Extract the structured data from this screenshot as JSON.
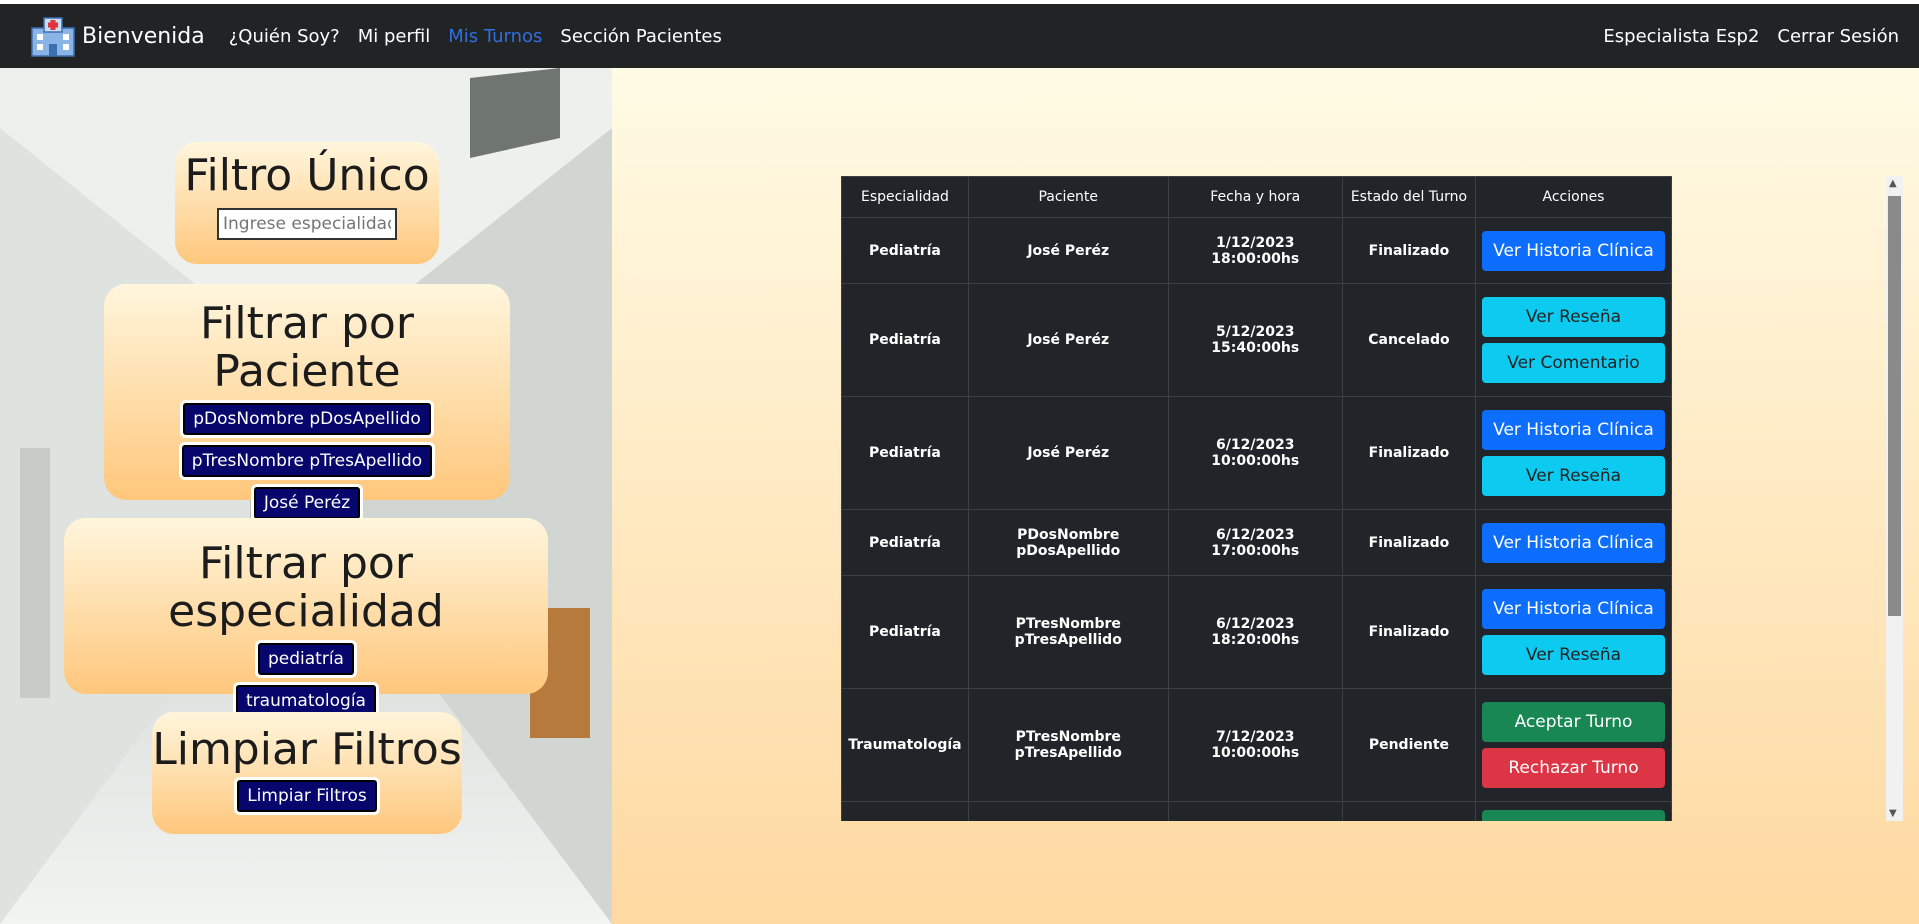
{
  "navbar": {
    "brand": "Bienvenida",
    "links": [
      "¿Quién Soy?",
      "Mi perfil",
      "Mis Turnos",
      "Sección Pacientes"
    ],
    "user": "Especialista Esp2",
    "logout": "Cerrar Sesión"
  },
  "filters": {
    "unique": {
      "title": "Filtro Único",
      "placeholder": "Ingrese especialidad"
    },
    "patient": {
      "title": "Filtrar por Paciente",
      "options": [
        "pDosNombre pDosApellido",
        "pTresNombre pTresApellido",
        "José Peréz"
      ]
    },
    "specialty": {
      "title": "Filtrar por especialidad",
      "options": [
        "pediatría",
        "traumatología"
      ]
    },
    "clear": {
      "title": "Limpiar Filtros",
      "button": "Limpiar Filtros"
    }
  },
  "table": {
    "headers": [
      "Especialidad",
      "Paciente",
      "Fecha y hora",
      "Estado del Turno",
      "Acciones"
    ],
    "rows": [
      {
        "especialidad": "Pediatría",
        "paciente": "José Peréz",
        "fecha": "1/12/2023 18:00:00hs",
        "estado": "Finalizado",
        "acciones": [
          "Ver Historia Clínica"
        ]
      },
      {
        "especialidad": "Pediatría",
        "paciente": "José Peréz",
        "fecha": "5/12/2023 15:40:00hs",
        "estado": "Cancelado",
        "acciones": [
          "Ver Reseña",
          "Ver Comentario"
        ]
      },
      {
        "especialidad": "Pediatría",
        "paciente": "José Peréz",
        "fecha": "6/12/2023 10:00:00hs",
        "estado": "Finalizado",
        "acciones": [
          "Ver Historia Clínica",
          "Ver Reseña"
        ]
      },
      {
        "especialidad": "Pediatría",
        "paciente": "PDosNombre pDosApellido",
        "fecha": "6/12/2023 17:00:00hs",
        "estado": "Finalizado",
        "acciones": [
          "Ver Historia Clínica"
        ]
      },
      {
        "especialidad": "Pediatría",
        "paciente": "PTresNombre pTresApellido",
        "fecha": "6/12/2023 18:20:00hs",
        "estado": "Finalizado",
        "acciones": [
          "Ver Historia Clínica",
          "Ver Reseña"
        ]
      },
      {
        "especialidad": "Traumatología",
        "paciente": "PTresNombre pTresApellido",
        "fecha": "7/12/2023 10:00:00hs",
        "estado": "Pendiente",
        "acciones": [
          "Aceptar Turno",
          "Rechazar Turno"
        ]
      }
    ]
  }
}
